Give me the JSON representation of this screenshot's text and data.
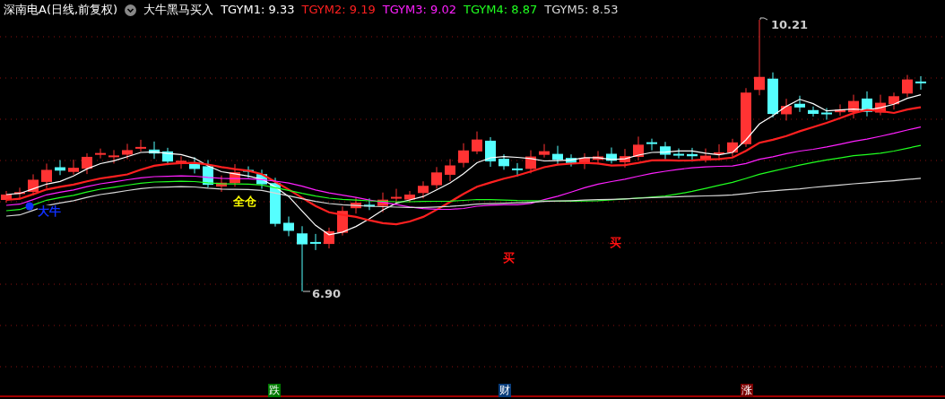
{
  "title": {
    "stock": "深南电A(日线,前复权)",
    "indicator": "大牛黑马买入"
  },
  "indicators": [
    {
      "label": "TGYM1: 9.33",
      "color": "#ffffff"
    },
    {
      "label": "TGYM2: 9.19",
      "color": "#ff2020"
    },
    {
      "label": "TGYM3: 9.02",
      "color": "#ff20ff"
    },
    {
      "label": "TGYM4: 8.87",
      "color": "#20ff20"
    },
    {
      "label": "TGYM5: 8.53",
      "color": "#d8d8d8"
    }
  ],
  "chart": {
    "high_label": "10.21",
    "low_label": "6.90",
    "signals": [
      {
        "text": "大牛",
        "color": "#1030ff"
      },
      {
        "text": "全仓",
        "color": "#ffff00"
      },
      {
        "text": "买",
        "color": "#ff1010"
      },
      {
        "text": "买",
        "color": "#ff1010"
      }
    ]
  },
  "bottom_markers": [
    {
      "text": "跌",
      "color": "#007a00"
    },
    {
      "text": "财",
      "color": "#0a3d7a"
    },
    {
      "text": "涨",
      "color": "#7a0000"
    }
  ]
}
